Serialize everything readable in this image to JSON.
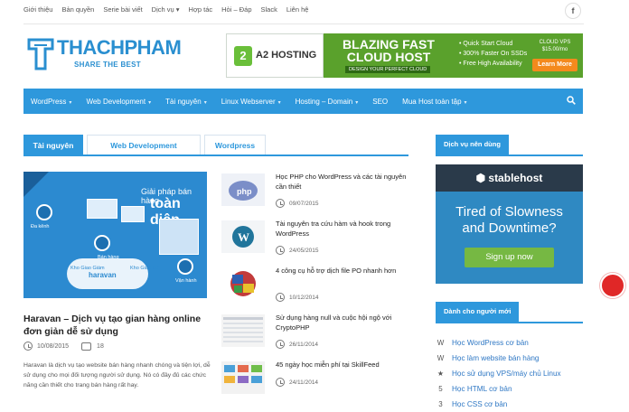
{
  "topbar": {
    "links": [
      "Giới thiệu",
      "Bản quyền",
      "Serie bài viết",
      "Dịch vụ ▾",
      "Hợp tác",
      "Hỏi – Đáp",
      "Slack",
      "Liên hệ"
    ],
    "facebook": "f"
  },
  "logo": {
    "name": "THACHPHAM",
    "tagline": "SHARE THE BEST"
  },
  "banner": {
    "brand": "A2 HOSTING",
    "headline_1": "BLAZING FAST",
    "headline_2": "CLOUD HOST",
    "sub": "DESIGN YOUR PERFECT CLOUD",
    "features": [
      "• Quick Start Cloud",
      "• 300% Faster On SSDs",
      "• Free High Availability"
    ],
    "price_1": "CLOUD VPS",
    "price_2": "$15.00/mo",
    "cta": "Learn More"
  },
  "nav": {
    "items": [
      {
        "label": "WordPress",
        "caret": "▾"
      },
      {
        "label": "Web Development",
        "caret": "▾"
      },
      {
        "label": "Tài nguyên",
        "caret": "▾"
      },
      {
        "label": "Linux Webserver",
        "caret": "▾"
      },
      {
        "label": "Hosting – Domain",
        "caret": "▾"
      },
      {
        "label": "SEO",
        "caret": ""
      },
      {
        "label": "Mua Host toàn tập",
        "caret": "▾"
      }
    ]
  },
  "tabs": [
    {
      "label": "Tài nguyên"
    },
    {
      "label": "Web Development"
    },
    {
      "label": "Wordpress"
    }
  ],
  "featured": {
    "image_text_1": "Giải pháp bán hàng",
    "image_text_2": "toàn diện",
    "image_cloud": "haravan",
    "image_labels": [
      "Đa kênh",
      "Bán hàng",
      "Vận hành",
      "Kho Giao Giám",
      "Kho Giao Cơ"
    ],
    "title": "Haravan – Dịch vụ tạo gian hàng online đơn giản dễ sử dụng",
    "date": "10/08/2015",
    "comments": "18",
    "excerpt": "Haravan là dịch vụ tạo website bán hàng nhanh chóng và tiện lợi, dễ sử dụng cho mọi đối tượng người sử dụng. Nó có đầy đủ các chức năng cần thiết cho trang bán hàng rất hay."
  },
  "posts": [
    {
      "title": "Học PHP cho WordPress và các tài nguyên cần thiết",
      "date": "09/07/2015",
      "thumb": "php-elephant"
    },
    {
      "title": "Tài nguyên tra cứu hàm và hook trong WordPress",
      "date": "24/05/2015",
      "thumb": "wordpress-logo"
    },
    {
      "title": "4 công cụ hỗ trợ dịch file PO nhanh hơn",
      "date": "10/12/2014",
      "thumb": "flags-globe"
    },
    {
      "title": "Sử dụng hàng null và cuộc hội ngộ với CryptoPHP",
      "date": "26/11/2014",
      "thumb": "code-table"
    },
    {
      "title": "45 ngày học miễn phí tại SkillFeed",
      "date": "24/11/2014",
      "thumb": "course-grid"
    }
  ],
  "sidebar": {
    "services_label": "Dịch vụ nên dùng",
    "ad": {
      "brand": "⬢ stablehost",
      "line_1": "Tired of Slowness",
      "line_2": "and Downtime?",
      "cta": "Sign up now"
    },
    "beginner_label": "Dành cho người mới",
    "links": [
      {
        "label": "Học WordPress cơ bản",
        "icon": "wordpress-icon",
        "glyph": "W"
      },
      {
        "label": "Học làm website bán hàng",
        "icon": "wordpress-icon",
        "glyph": "W"
      },
      {
        "label": "Học sử dụng VPS/máy chủ Linux",
        "icon": "star-icon",
        "glyph": "★"
      },
      {
        "label": "Học HTML cơ bản",
        "icon": "html5-icon",
        "glyph": "5"
      },
      {
        "label": "Học CSS cơ bản",
        "icon": "css3-icon",
        "glyph": "3"
      }
    ]
  },
  "colors": {
    "accent": "#2e98dc",
    "notification": "#e02727"
  }
}
